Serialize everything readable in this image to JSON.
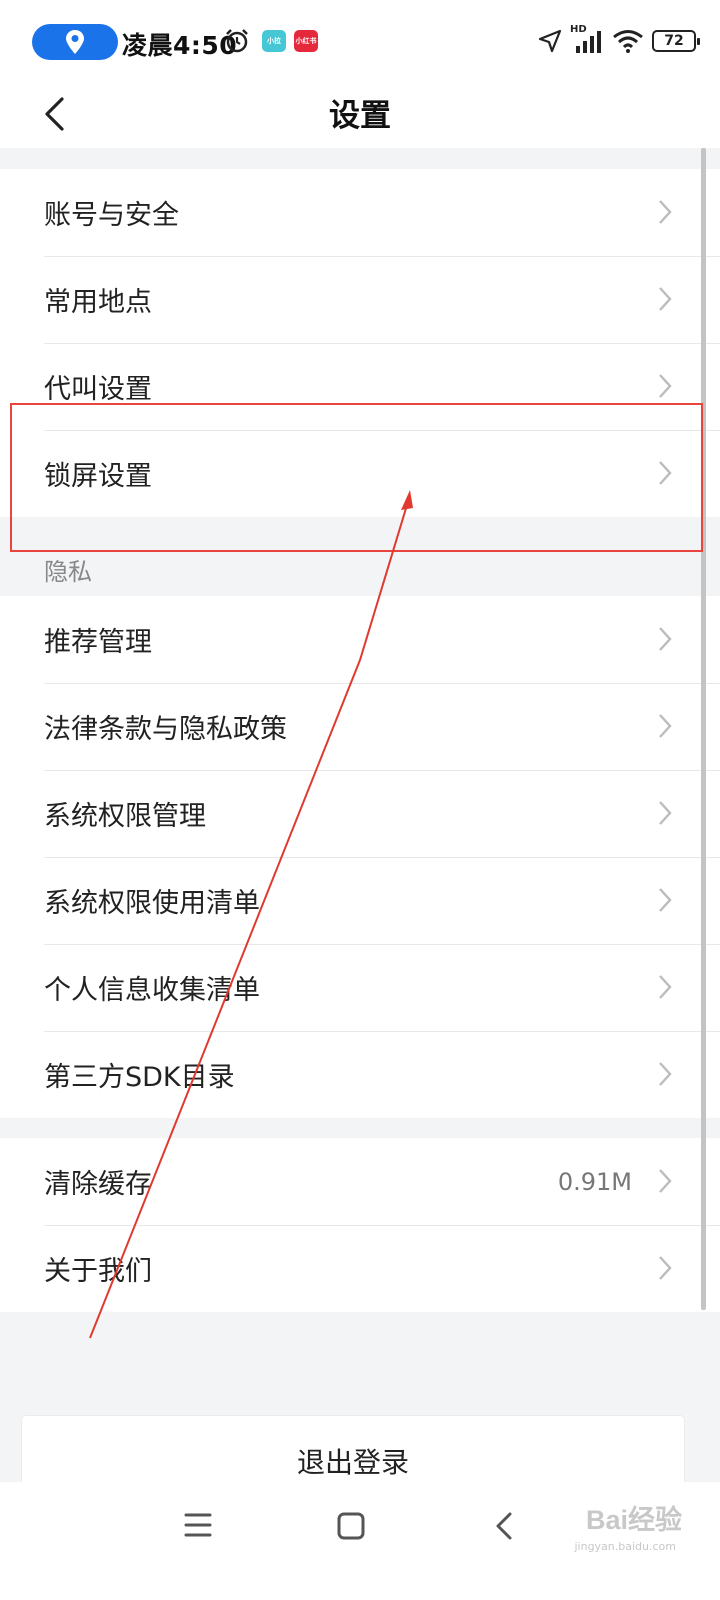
{
  "status_bar": {
    "time": "凌晨4:50",
    "badges": {
      "xiaoban": "小拉",
      "xhs": "小红书"
    },
    "network": "HD",
    "battery": "72",
    "icons": [
      "location-pin-icon",
      "alarm-icon",
      "navigation-arrow-icon",
      "signal-icon",
      "wifi-icon",
      "battery-icon"
    ]
  },
  "header": {
    "title": "设置",
    "back_icon": "chevron-left-icon"
  },
  "groups": [
    {
      "items": [
        {
          "label": "账号与安全"
        },
        {
          "label": "常用地点"
        },
        {
          "label": "代叫设置"
        },
        {
          "label": "锁屏设置"
        }
      ]
    },
    {
      "section_label": "隐私",
      "items": [
        {
          "label": "推荐管理"
        },
        {
          "label": "法律条款与隐私政策"
        },
        {
          "label": "系统权限管理"
        },
        {
          "label": "系统权限使用清单"
        },
        {
          "label": "个人信息收集清单"
        },
        {
          "label": "第三方SDK目录"
        }
      ]
    },
    {
      "items": [
        {
          "label": "清除缓存",
          "value": "0.91M"
        },
        {
          "label": "关于我们"
        }
      ]
    }
  ],
  "logout": {
    "label": "退出登录"
  },
  "nav_bar": {
    "icons": [
      "menu-icon",
      "home-square-icon",
      "back-icon"
    ]
  },
  "watermark": {
    "text": "Bai经验",
    "sub": "jingyan.baidu.com"
  },
  "colors": {
    "accent_pill": "#1a73e8",
    "annotation": "#e8453c",
    "background": "#f3f4f6"
  }
}
